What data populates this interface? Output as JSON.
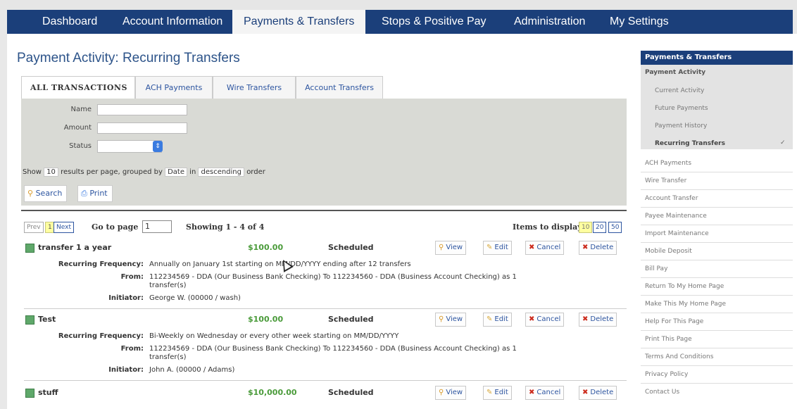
{
  "nav": {
    "tabs": [
      {
        "label": "Dashboard"
      },
      {
        "label": "Account Information"
      },
      {
        "label": "Payments & Transfers",
        "active": true
      },
      {
        "label": "Stops & Positive Pay"
      },
      {
        "label": "Administration"
      },
      {
        "label": "My Settings"
      }
    ]
  },
  "page": {
    "title": "Payment Activity: Recurring Transfers"
  },
  "subtabs": [
    {
      "label": "ALL TRANSACTIONS",
      "active": true
    },
    {
      "label": "ACH Payments"
    },
    {
      "label": "Wire Transfers"
    },
    {
      "label": "Account Transfers"
    }
  ],
  "filter": {
    "name_label": "Name",
    "name_value": "",
    "amount_label": "Amount",
    "amount_value": "",
    "status_label": "Status",
    "status_value": "",
    "show_text": "Show",
    "results_count": "10",
    "results_text": "results per page, grouped by",
    "group_by": "Date",
    "in_text": "in",
    "order": "descending",
    "order_text": "order",
    "search_label": "Search",
    "print_label": "Print"
  },
  "pager": {
    "prev": "Prev",
    "current_page": "1",
    "next": "Next",
    "goto_label": "Go to page",
    "goto_value": "1",
    "showing": "Showing 1 - 4 of 4",
    "items_label": "Items to display:",
    "items_options": [
      "10",
      "20",
      "50"
    ]
  },
  "actions": {
    "view": "View",
    "edit": "Edit",
    "cancel": "Cancel",
    "delete": "Delete"
  },
  "transactions": [
    {
      "name": "transfer 1 a year",
      "amount": "$100.00",
      "status": "Scheduled",
      "freq_label": "Recurring Frequency:",
      "freq": "Annually on January 1st starting on MM/DD/YYYY ending after 12 transfers",
      "from_label": "From:",
      "from": "112234569 - DDA (Our Business Bank Checking) To 112234560 - DDA (Business Account Checking) as 1 transfer(s)",
      "initiator_label": "Initiator:",
      "initiator": "George W. (00000 / wash)"
    },
    {
      "name": "Test",
      "amount": "$100.00",
      "status": "Scheduled",
      "freq_label": "Recurring Frequency:",
      "freq": "Bi-Weekly on Wednesday or every other week starting on MM/DD/YYYY",
      "from_label": "From:",
      "from": "112234569 - DDA (Our Business Bank Checking) To 112234560 - DDA (Business Account Checking) as 1 transfer(s)",
      "initiator_label": "Initiator:",
      "initiator": "John A. (00000 / Adams)"
    },
    {
      "name": "stuff",
      "amount": "$10,000.00",
      "status": "Scheduled"
    }
  ],
  "sidebar": {
    "header": "Payments & Transfers",
    "subheader": "Payment Activity",
    "sub_items": [
      {
        "label": "Current Activity"
      },
      {
        "label": "Future Payments"
      },
      {
        "label": "Payment History"
      },
      {
        "label": "Recurring Transfers",
        "active": true
      }
    ],
    "items": [
      {
        "label": "ACH Payments"
      },
      {
        "label": "Wire Transfer"
      },
      {
        "label": "Account Transfer"
      },
      {
        "label": "Payee Maintenance"
      },
      {
        "label": "Import Maintenance"
      },
      {
        "label": "Mobile Deposit"
      },
      {
        "label": "Bill Pay"
      },
      {
        "label": "Return To My Home Page"
      },
      {
        "label": "Make This My Home Page"
      },
      {
        "label": "Help For This Page"
      },
      {
        "label": "Print This Page"
      },
      {
        "label": "Terms And Conditions"
      },
      {
        "label": "Privacy Policy"
      },
      {
        "label": "Contact Us"
      }
    ]
  },
  "colors": {
    "nav_bg": "#1b3f7a",
    "accent": "#2c5389",
    "amount": "#4a9b3a",
    "cancel": "#cc2b1d"
  }
}
